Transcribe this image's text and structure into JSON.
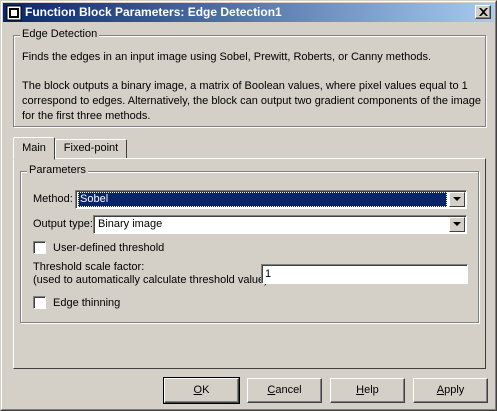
{
  "window": {
    "title": "Function Block Parameters: Edge Detection1",
    "close_icon": "close-icon",
    "app_icon": "simulink-block-icon"
  },
  "description": {
    "group_label": "Edge Detection",
    "line1": "Finds the edges in an input image using Sobel, Prewitt, Roberts, or Canny methods.",
    "line2": "The block outputs a binary image, a matrix of Boolean values, where pixel values equal to 1",
    "line3": "correspond to edges.  Alternatively, the block can output two gradient components of the image",
    "line4": "for the first three methods."
  },
  "tabs": [
    {
      "label": "Main",
      "active": true
    },
    {
      "label": "Fixed-point",
      "active": false
    }
  ],
  "parameters": {
    "group_label": "Parameters",
    "method_label": "Method:",
    "method_value": "Sobel",
    "output_type_label": "Output type:",
    "output_type_value": "Binary image",
    "user_threshold_label": "User-defined threshold",
    "user_threshold_checked": false,
    "threshold_scale_label_1": "Threshold scale factor:",
    "threshold_scale_label_2": "(used to automatically calculate threshold value)",
    "threshold_scale_value": "1",
    "edge_thinning_label": "Edge thinning",
    "edge_thinning_checked": false
  },
  "buttons": {
    "ok": {
      "mnemonic": "O",
      "rest": "K"
    },
    "cancel": {
      "mnemonic": "C",
      "rest": "ancel"
    },
    "help": {
      "mnemonic": "H",
      "rest": "elp"
    },
    "apply": {
      "mnemonic": "A",
      "rest": "pply"
    }
  },
  "colors": {
    "face": "#d4d0c8",
    "titlebar_start": "#0a246a",
    "titlebar_end": "#a6caf0",
    "selection": "#0a246a"
  }
}
